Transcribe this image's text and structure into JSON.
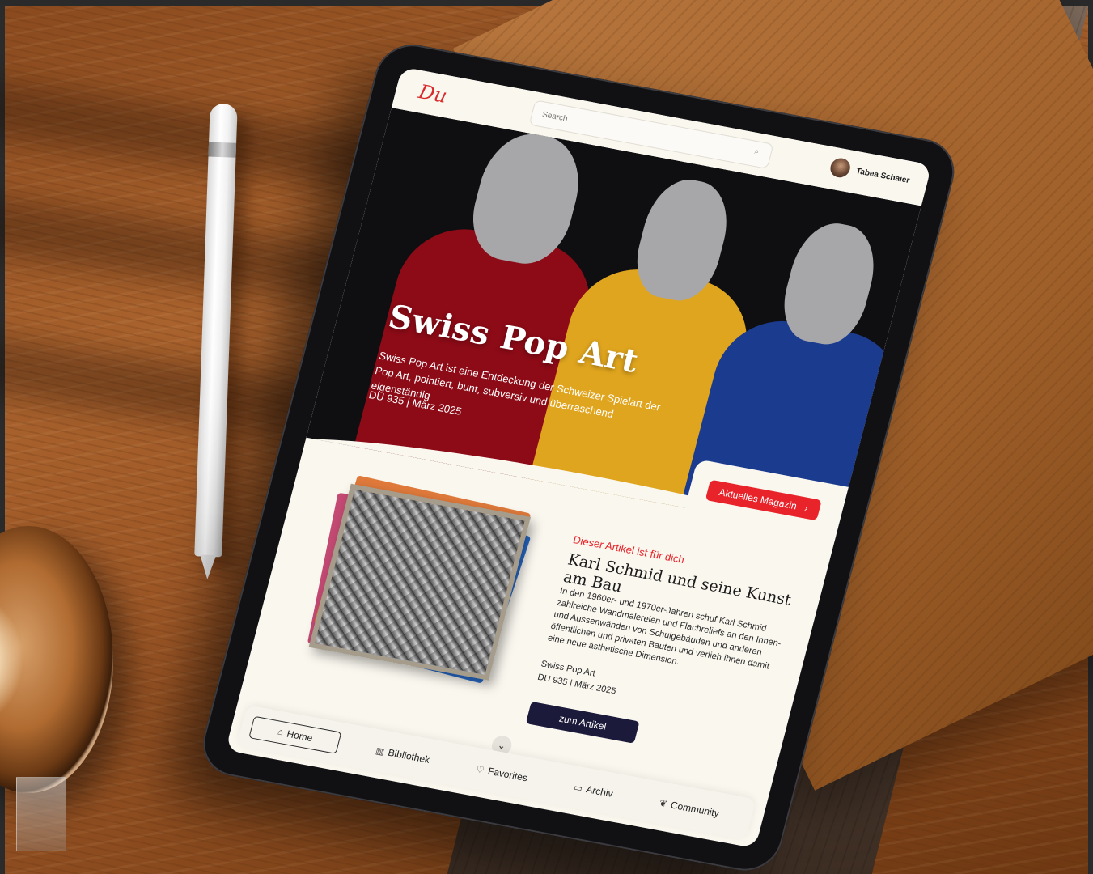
{
  "app": {
    "logo": "Du",
    "search": {
      "placeholder": "Search"
    },
    "user": {
      "name": "Tabea Schaier"
    }
  },
  "hero": {
    "title": "Swiss Pop Art",
    "subtitle": "Swiss Pop Art ist eine Entdeckung der Schweizer Spielart der Pop Art, pointiert, bunt, subversiv und überraschend eigenständig",
    "meta": "DU 935 | März 2025",
    "magazine_button": "Aktuelles Magazin",
    "colors": {
      "red": "#8c0b17",
      "yellow": "#e0a51e",
      "blue": "#1b3b8f",
      "figure_grey": "#a7a7a9"
    }
  },
  "article": {
    "kicker": "Dieser Artikel ist für dich",
    "title": "Karl Schmid und seine Kunst am Bau",
    "body": "In den 1960er- und 1970er-Jahren schuf Karl Schmid zahlreiche Wandmalereien und Flachreliefs an den Innen- und Aussenwänden von Schulgebäuden und anderen öffentlichen und privaten Bauten und verlieh ihnen damit eine neue ästhetische Dimension.",
    "series": "Swiss Pop Art",
    "issue": "DU 935 | März 2025",
    "cta": "zum Artikel"
  },
  "nav": {
    "items": [
      {
        "label": "Home",
        "icon": "home-icon",
        "glyph": "⌂"
      },
      {
        "label": "Bibliothek",
        "icon": "library-icon",
        "glyph": "▥"
      },
      {
        "label": "Favorites",
        "icon": "heart-icon",
        "glyph": "♡"
      },
      {
        "label": "Archiv",
        "icon": "archive-icon",
        "glyph": "▭"
      },
      {
        "label": "Community",
        "icon": "community-icon",
        "glyph": "❦"
      }
    ]
  },
  "colors": {
    "accent": "#e8232a",
    "cta": "#1b1a3a",
    "background": "#faf7ef"
  }
}
